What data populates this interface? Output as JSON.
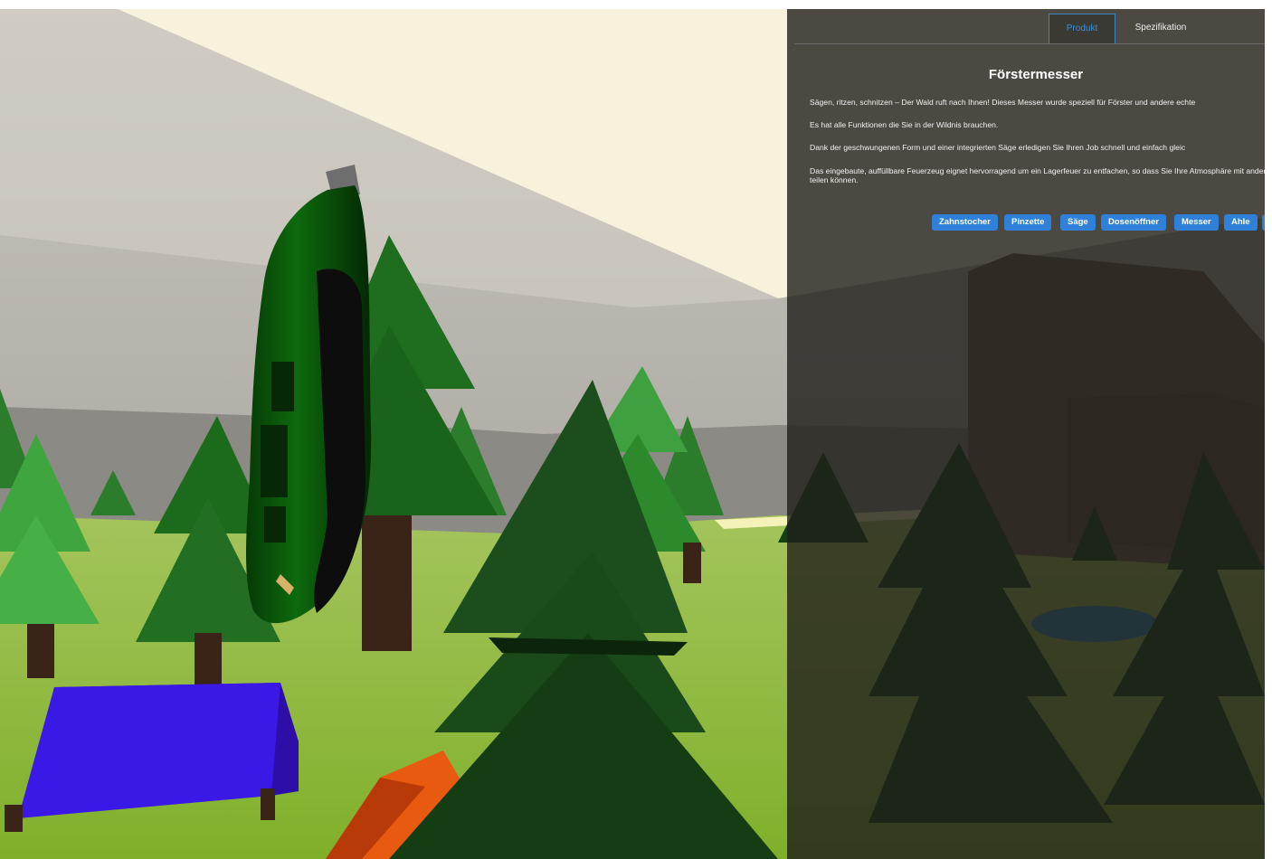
{
  "panel": {
    "tabs": [
      {
        "label": "Produkt",
        "active": true
      },
      {
        "label": "Spezifikation",
        "active": false
      }
    ],
    "title": "Förstermesser",
    "paragraphs": [
      "Sägen, ritzen, schnitzen – Der Wald ruft nach Ihnen! Dieses Messer wurde speziell für Förster und andere echte",
      "Es hat alle Funktionen die Sie in der Wildnis brauchen.",
      "Dank der geschwungenen Form und einer integrierten Säge erledigen Sie Ihren Job schnell und einfach gleic",
      "Das eingebaute, auffüllbare Feuerzeug eignet hervorragend um ein Lagerfeuer zu entfachen, so dass Sie Ihre Atmosphäre mit anderen teilen können."
    ],
    "function_buttons": [
      "Zahnstocher",
      "Pinzette",
      "Säge",
      "Dosenöffner",
      "Messer",
      "Ahle",
      ""
    ]
  },
  "colors": {
    "accent": "#2f80d8",
    "panel_bg": "#201e1a",
    "knife_green": "#0a5a0a",
    "tent_blue": "#3a16e8",
    "grass": "#8fb838"
  }
}
